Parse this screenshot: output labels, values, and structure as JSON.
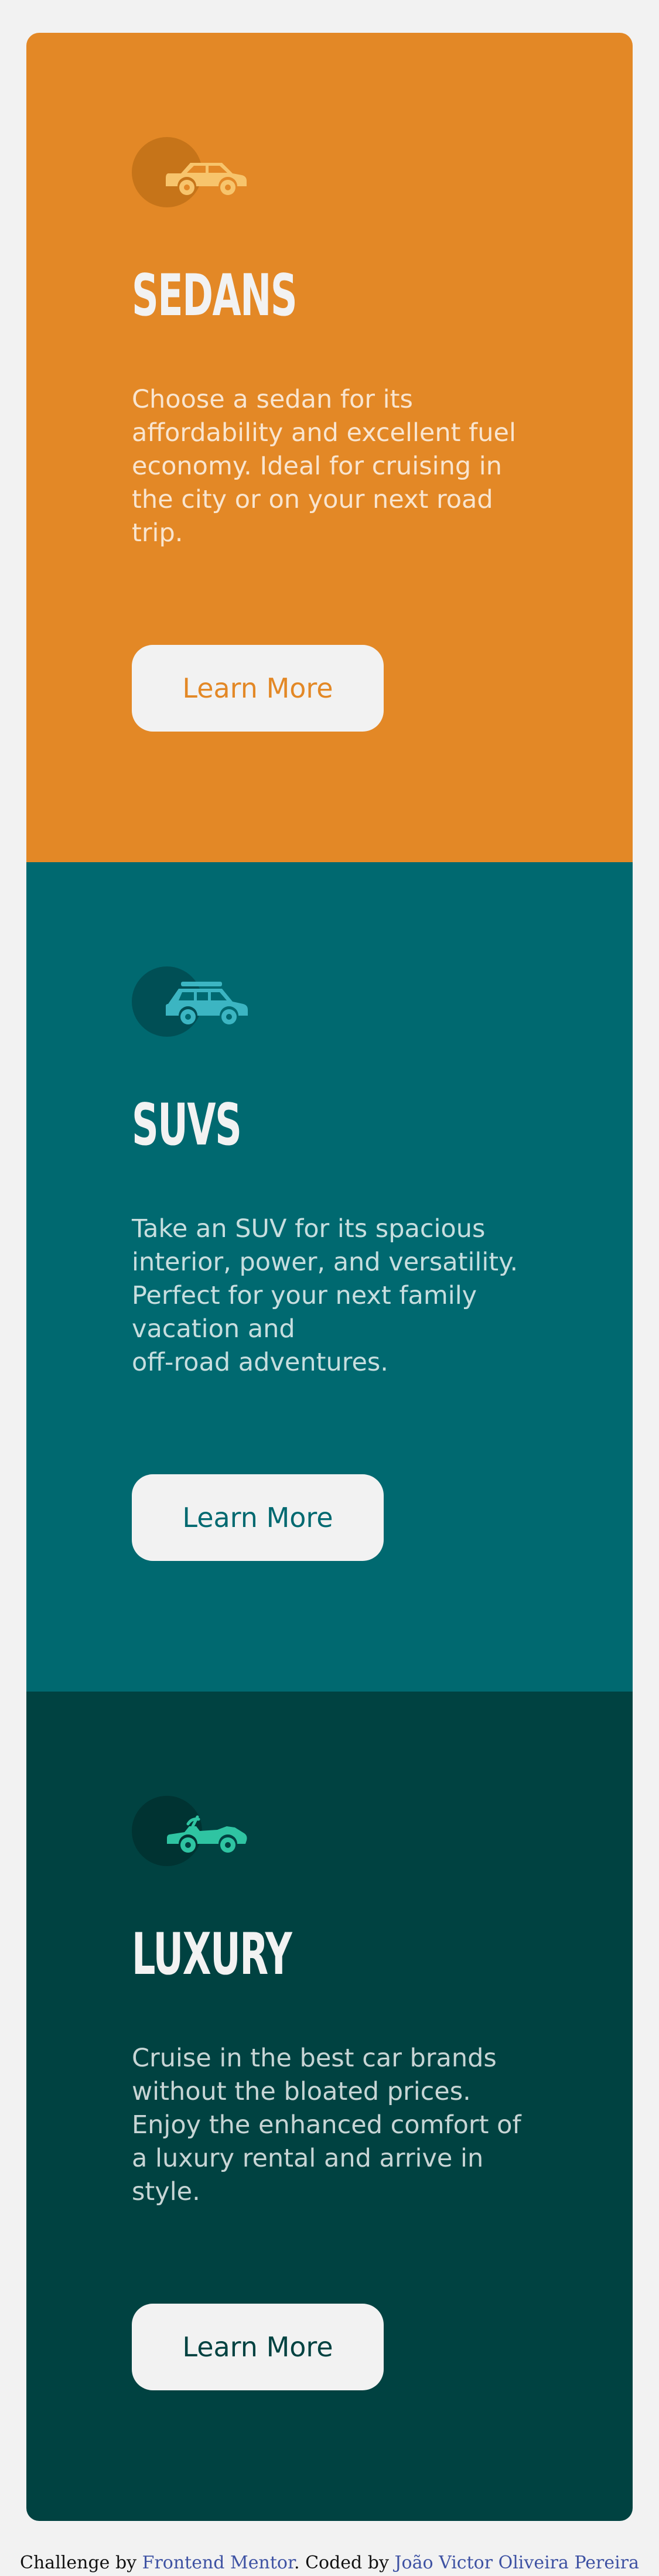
{
  "cards": [
    {
      "icon": "sedan-car-icon",
      "title": "SEDANS",
      "description": "Choose a sedan for its affordability and excellent fuel economy. Ideal for cruising in the city or on your next road trip.",
      "button_label": "Learn More",
      "accent_color": "#e38826"
    },
    {
      "icon": "suv-car-icon",
      "title": "SUVS",
      "description": "Take an SUV for its spacious interior, power, and versatility. Perfect for your next family vacation and\noff-road adventures.",
      "button_label": "Learn More",
      "accent_color": "#006970"
    },
    {
      "icon": "luxury-car-icon",
      "title": "LUXURY",
      "description": "Cruise in the best car brands without the bloated prices. Enjoy the enhanced comfort of a luxury rental and arrive in style.",
      "button_label": "Learn More",
      "accent_color": "#004241"
    }
  ],
  "footer": {
    "prefix": "Challenge by ",
    "challenge_link": "Frontend Mentor",
    "middle": ". Coded by ",
    "author_link": "João Victor Oliveira Pereira"
  },
  "colors": {
    "page_background": "#f2f2f2",
    "sedan_icon": "#f7c46c",
    "suv_icon": "#3cb5c2",
    "luxury_icon": "#2fc4a2",
    "link": "#3e52a3"
  }
}
